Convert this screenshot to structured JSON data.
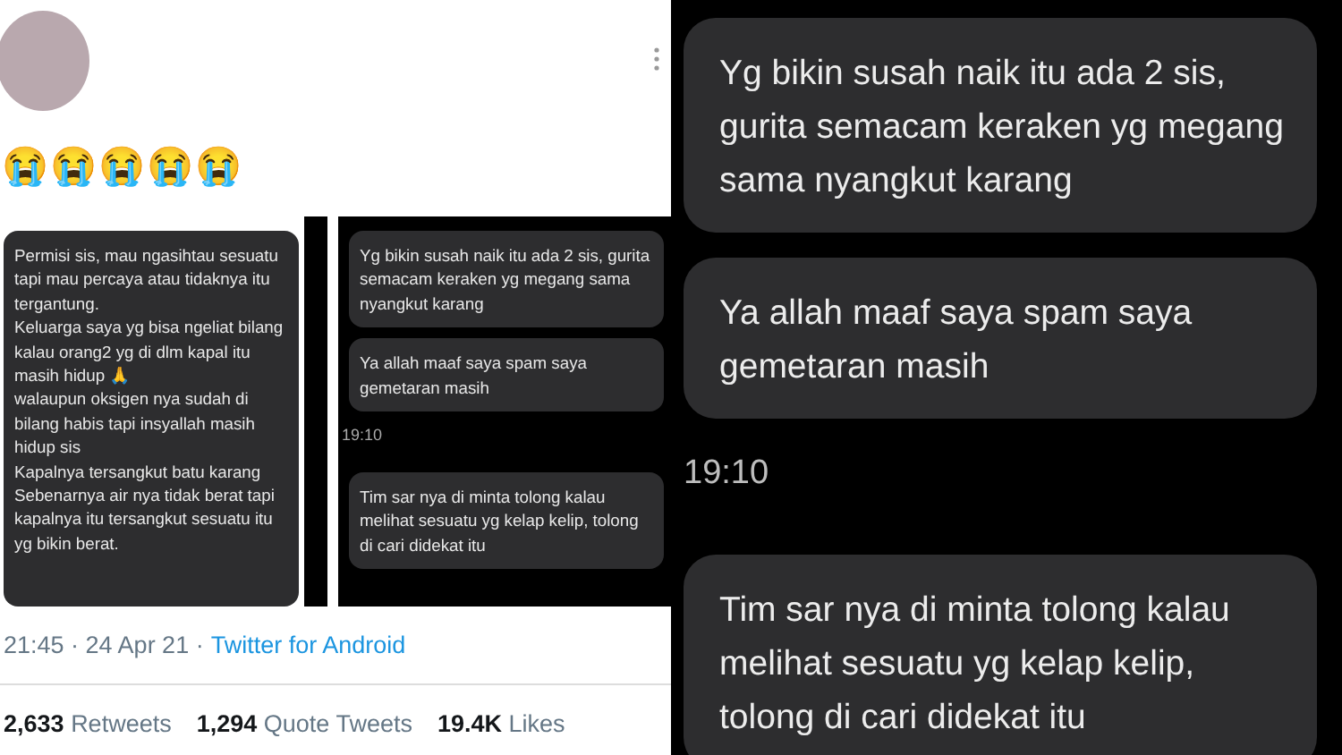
{
  "tweet": {
    "text": "😭😭😭😭😭",
    "media": [
      {
        "items": [
          {
            "kind": "bubble",
            "text": "Permisi sis, mau ngasihtau sesuatu tapi mau percaya atau tidaknya itu tergantung.\nKeluarga saya yg bisa ngeliat bilang kalau orang2 yg di dlm kapal itu masih hidup 🙏\nwalaupun oksigen nya sudah di bilang habis tapi insyallah masih hidup sis\nKapalnya tersangkut batu karang\nSebenarnya air nya tidak berat tapi kapalnya itu tersangkut sesuatu itu yg bikin berat."
          }
        ]
      },
      {
        "items": [
          {
            "kind": "bubble",
            "text": "Yg bikin susah naik itu ada 2 sis, gurita semacam keraken yg megang sama nyangkut karang"
          },
          {
            "kind": "bubble",
            "text": "Ya allah maaf saya spam saya gemetaran masih"
          },
          {
            "kind": "time",
            "text": "19:10"
          },
          {
            "kind": "bubble",
            "text": "Tim sar nya di minta tolong kalau melihat sesuatu yg kelap kelip, tolong di cari didekat itu"
          }
        ]
      }
    ],
    "timestamp": "21:45 · 24 Apr 21 ·",
    "source": "Twitter for Android",
    "stats": [
      {
        "count": "2,633",
        "label": "Retweets"
      },
      {
        "count": "1,294",
        "label": "Quote Tweets"
      },
      {
        "count": "19.4K",
        "label": "Likes"
      }
    ]
  },
  "zoomed_chat": {
    "items": [
      {
        "kind": "bubble",
        "text": "Yg bikin susah naik itu ada 2 sis, gurita semacam keraken yg megang sama nyangkut karang"
      },
      {
        "kind": "bubble",
        "text": "Ya allah maaf saya spam saya gemetaran masih"
      },
      {
        "kind": "time",
        "text": "19:10"
      },
      {
        "kind": "bubble",
        "text": "Tim sar nya di minta tolong kalau melihat sesuatu yg kelap kelip, tolong di cari didekat itu"
      }
    ]
  }
}
